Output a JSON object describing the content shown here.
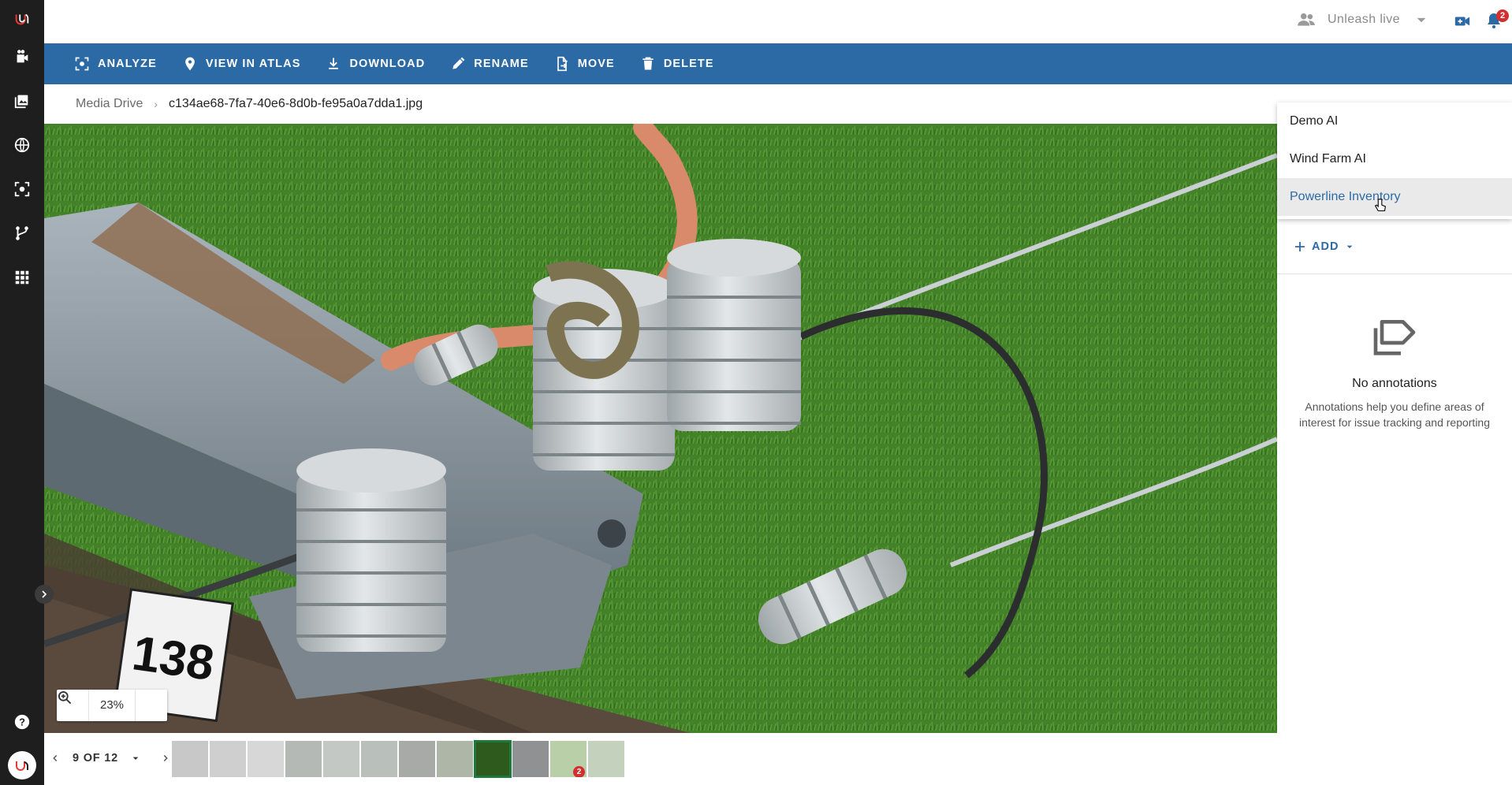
{
  "topbar": {
    "account_name": "Unleash live",
    "notification_count": "2"
  },
  "actions": {
    "analyze": "ANALYZE",
    "view_in_atlas": "VIEW IN ATLAS",
    "download": "DOWNLOAD",
    "rename": "RENAME",
    "move": "MOVE",
    "delete": "DELETE"
  },
  "breadcrumb": {
    "root": "Media Drive",
    "separator": "›",
    "file": "c134ae68-7fa7-40e6-8d0b-fe95a0a7dda1.jpg"
  },
  "viewer": {
    "zoom_level": "23%",
    "sign_text": "138"
  },
  "pager": {
    "label": "9 OF 12",
    "current": 9,
    "total": 12
  },
  "thumbnails": [
    {
      "color": "#c8c8c8"
    },
    {
      "color": "#cfcfcf"
    },
    {
      "color": "#d7d7d7"
    },
    {
      "color": "#b5b9b6"
    },
    {
      "color": "#c4c8c4"
    },
    {
      "color": "#b9bfbb"
    },
    {
      "color": "#a7aaa7"
    },
    {
      "color": "#aeb6a8"
    },
    {
      "color": "#2f5a1e"
    },
    {
      "color": "#8f9192"
    },
    {
      "color": "#b8cfa8",
      "badge": "2"
    },
    {
      "color": "#c3d1bd"
    }
  ],
  "ai_menu": {
    "items": [
      "Demo AI",
      "Wind Farm AI",
      "Powerline Inventory"
    ],
    "hovered_index": 2
  },
  "annotations": {
    "add_label": "ADD",
    "empty_title": "No annotations",
    "empty_description": "Annotations help you define areas of interest for issue tracking and reporting"
  },
  "colors": {
    "brand_blue": "#2c6aa6",
    "rail_bg": "#1e1e1e",
    "badge_red": "#d32f2f",
    "active_thumb_border": "#1e7a3c"
  }
}
